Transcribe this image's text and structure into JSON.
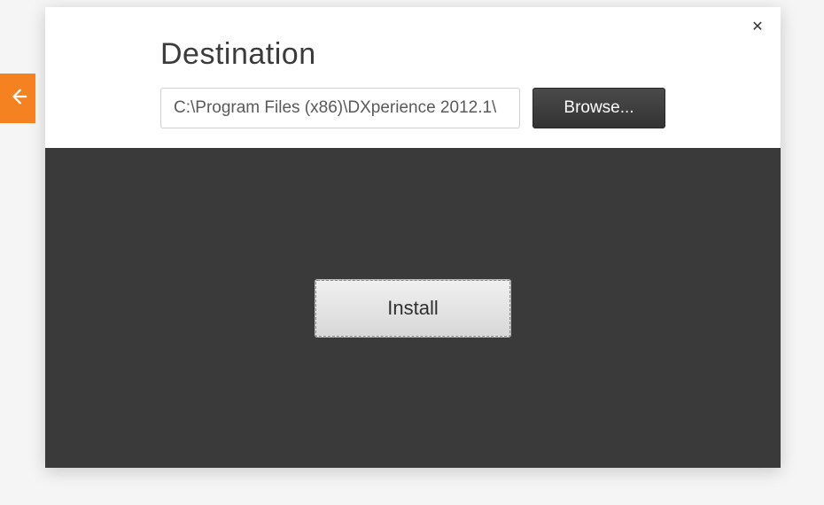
{
  "header": {
    "title": "Destination"
  },
  "destination": {
    "path": "C:\\Program Files (x86)\\DXperience 2012.1\\",
    "browse_label": "Browse..."
  },
  "actions": {
    "install_label": "Install"
  },
  "colors": {
    "accent": "#f58220",
    "panel_dark": "#3a3a3a"
  }
}
